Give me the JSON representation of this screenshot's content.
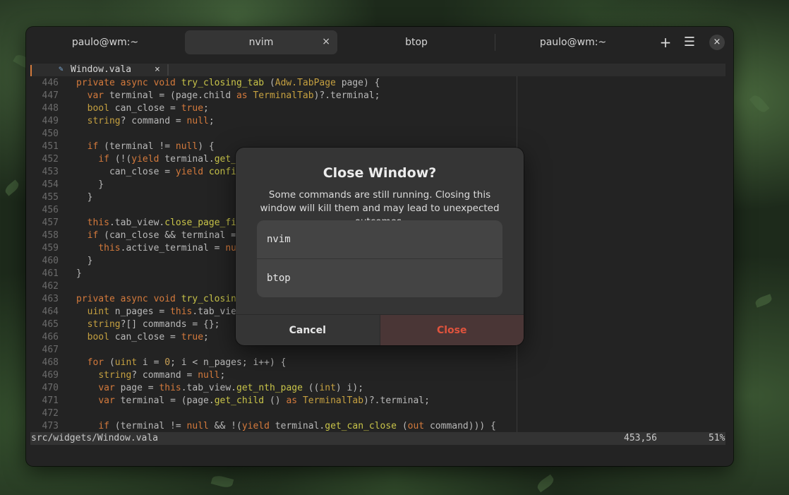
{
  "window": {
    "tabs": [
      {
        "title": "paulo@wm:~",
        "active": false
      },
      {
        "title": "nvim",
        "active": true,
        "close": "×"
      },
      {
        "title": "btop",
        "active": false
      },
      {
        "title": "paulo@wm:~",
        "active": false
      }
    ],
    "header_buttons": {
      "new_tab": "+",
      "menu": "☰",
      "close": "×"
    }
  },
  "editor": {
    "buffer_tab": {
      "icon": "vala-file-icon",
      "name": "Window.vala",
      "close": "×"
    },
    "lines": [
      {
        "n": "446",
        "html": "<span class=\"k\">private async void </span><span class=\"f\">try_closing_tab</span> (<span class=\"t\">Adw.TabPage</span> page) {"
      },
      {
        "n": "447",
        "html": "  <span class=\"k\">var</span> terminal = (page.child <span class=\"k\">as</span> <span class=\"t\">TerminalTab</span>)?.terminal;"
      },
      {
        "n": "448",
        "html": "  <span class=\"t\">bool</span> can_close = <span class=\"k\">true</span>;"
      },
      {
        "n": "449",
        "html": "  <span class=\"t\">string</span>? command = <span class=\"k\">null</span>;"
      },
      {
        "n": "450",
        "html": ""
      },
      {
        "n": "451",
        "html": "  <span class=\"k\">if</span> (terminal != <span class=\"k\">null</span>) {"
      },
      {
        "n": "452",
        "html": "    <span class=\"k\">if</span> (!(<span class=\"k\">yield</span> terminal.<span class=\"f\">get_can_close</span> (<span class=\"k\">out</span> command)))"
      },
      {
        "n": "453",
        "html": "      can_close = <span class=\"k\">yield</span> <span class=\"f\">confirm_closing</span> ({ command });"
      },
      {
        "n": "454",
        "html": "    }"
      },
      {
        "n": "455",
        "html": "  }"
      },
      {
        "n": "456",
        "html": ""
      },
      {
        "n": "457",
        "html": "  <span class=\"k\">this</span>.tab_view.<span class=\"f\">close_page_finish</span> (page, can_close);"
      },
      {
        "n": "458",
        "html": "  <span class=\"k\">if</span> (can_close &amp;&amp; terminal == <span class=\"k\">this</span>.active_terminal)"
      },
      {
        "n": "459",
        "html": "    <span class=\"k\">this</span>.active_terminal = <span class=\"k\">null</span>;"
      },
      {
        "n": "460",
        "html": "  }"
      },
      {
        "n": "461",
        "html": "}"
      },
      {
        "n": "462",
        "html": ""
      },
      {
        "n": "463",
        "html": "<span class=\"k\">private async void </span><span class=\"f\">try_closing_window</span> () {"
      },
      {
        "n": "464",
        "html": "  <span class=\"t\">uint</span> n_pages = <span class=\"k\">this</span>.tab_view.n_pages;"
      },
      {
        "n": "465",
        "html": "  <span class=\"t\">string</span>?[] commands = {};"
      },
      {
        "n": "466",
        "html": "  <span class=\"t\">bool</span> can_close = <span class=\"k\">true</span>;"
      },
      {
        "n": "467",
        "html": ""
      },
      {
        "n": "468",
        "html": "  <span class=\"k\">for</span> (<span class=\"t\">uint</span> i = <span class=\"c\">0</span>; i &lt; n_pages; i++) {"
      },
      {
        "n": "469",
        "html": "    <span class=\"t\">string</span>? command = <span class=\"k\">null</span>;"
      },
      {
        "n": "470",
        "html": "    <span class=\"k\">var</span> page = <span class=\"k\">this</span>.tab_view.<span class=\"f\">get_nth_page</span> ((<span class=\"t\">int</span>) i);"
      },
      {
        "n": "471",
        "html": "    <span class=\"k\">var</span> terminal = (page.<span class=\"f\">get_child</span> () <span class=\"k\">as</span> <span class=\"t\">TerminalTab</span>)?.terminal;"
      },
      {
        "n": "472",
        "html": ""
      },
      {
        "n": "473",
        "html": "    <span class=\"k\">if</span> (terminal != <span class=\"k\">null</span> &amp;&amp; !(<span class=\"k\">yield</span> terminal.<span class=\"f\">get_can_close</span> (<span class=\"k\">out</span> command))) {"
      }
    ],
    "status": {
      "file": "src/widgets/Window.vala",
      "position": "453,56",
      "percent": "51%"
    }
  },
  "dialog": {
    "title": "Close Window?",
    "body": "Some commands are still running. Closing this window will kill them and may lead to unexpected outcomes.",
    "processes": [
      "nvim",
      "btop"
    ],
    "cancel_label": "Cancel",
    "close_label": "Close"
  },
  "colors": {
    "destructive": "#e0533d",
    "accent_mark": "#d27a3c"
  }
}
